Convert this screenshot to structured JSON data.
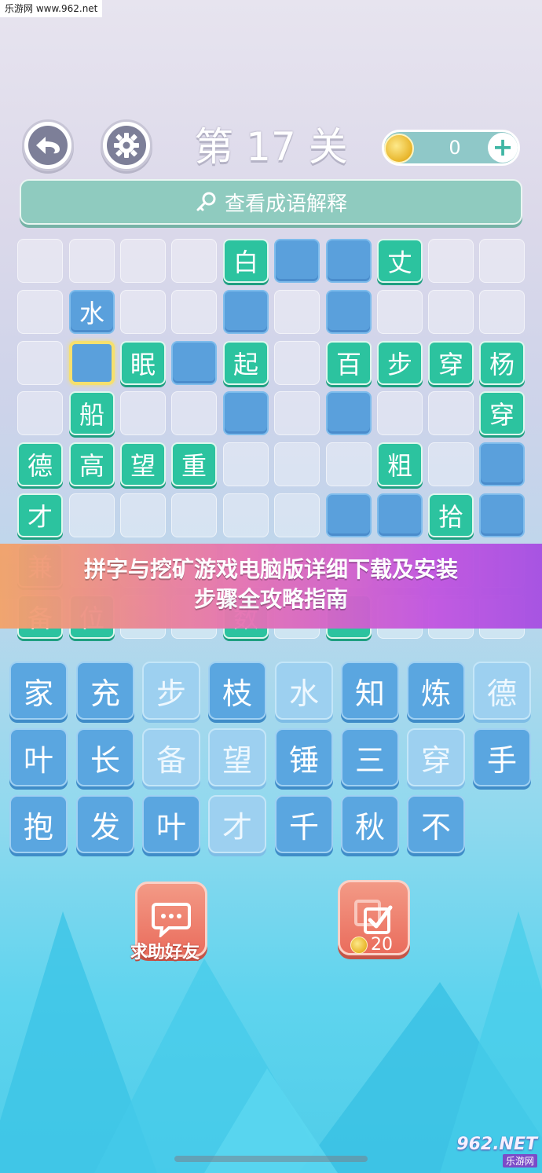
{
  "watermark_top": "乐游网 www.962.net",
  "header": {
    "back_icon": "back-arrow-icon",
    "settings_icon": "gear-icon",
    "level_title": "第 17 关",
    "coins": "0",
    "plus": "+"
  },
  "explain": {
    "label": "查看成语解释",
    "icon": "magnifier-key-icon"
  },
  "banner": {
    "line1": "拼字与挖矿游戏电脑版详细下载及安装",
    "line2": "步骤全攻略指南"
  },
  "grid": {
    "rows": [
      [
        {
          "t": "empty"
        },
        {
          "t": "empty"
        },
        {
          "t": "empty"
        },
        {
          "t": "empty"
        },
        {
          "t": "green",
          "c": "白"
        },
        {
          "t": "blue"
        },
        {
          "t": "blue"
        },
        {
          "t": "green",
          "c": "丈"
        },
        {
          "t": "empty"
        },
        {
          "t": "empty"
        }
      ],
      [
        {
          "t": "empty"
        },
        {
          "t": "blue",
          "c": "水"
        },
        {
          "t": "empty"
        },
        {
          "t": "empty"
        },
        {
          "t": "blue"
        },
        {
          "t": "empty"
        },
        {
          "t": "blue"
        },
        {
          "t": "empty"
        },
        {
          "t": "empty"
        },
        {
          "t": "empty"
        }
      ],
      [
        {
          "t": "empty"
        },
        {
          "t": "selected"
        },
        {
          "t": "green",
          "c": "眠"
        },
        {
          "t": "blue"
        },
        {
          "t": "green",
          "c": "起"
        },
        {
          "t": "empty"
        },
        {
          "t": "green",
          "c": "百"
        },
        {
          "t": "green",
          "c": "步"
        },
        {
          "t": "green",
          "c": "穿"
        },
        {
          "t": "green",
          "c": "杨"
        }
      ],
      [
        {
          "t": "empty"
        },
        {
          "t": "green",
          "c": "船"
        },
        {
          "t": "empty"
        },
        {
          "t": "empty"
        },
        {
          "t": "blue"
        },
        {
          "t": "empty"
        },
        {
          "t": "blue"
        },
        {
          "t": "empty"
        },
        {
          "t": "empty"
        },
        {
          "t": "green",
          "c": "穿"
        }
      ],
      [
        {
          "t": "green",
          "c": "德"
        },
        {
          "t": "green",
          "c": "高"
        },
        {
          "t": "green",
          "c": "望"
        },
        {
          "t": "green",
          "c": "重"
        },
        {
          "t": "empty"
        },
        {
          "t": "empty"
        },
        {
          "t": "empty"
        },
        {
          "t": "green",
          "c": "粗"
        },
        {
          "t": "empty"
        },
        {
          "t": "blue"
        }
      ],
      [
        {
          "t": "green",
          "c": "才"
        },
        {
          "t": "empty"
        },
        {
          "t": "empty"
        },
        {
          "t": "empty"
        },
        {
          "t": "empty"
        },
        {
          "t": "empty"
        },
        {
          "t": "blue"
        },
        {
          "t": "blue"
        },
        {
          "t": "green",
          "c": "拾"
        },
        {
          "t": "blue"
        }
      ],
      [
        {
          "t": "green",
          "c": "兼"
        },
        {
          "t": "empty"
        },
        {
          "t": "empty"
        },
        {
          "t": "empty"
        },
        {
          "t": "empty"
        },
        {
          "t": "empty"
        },
        {
          "t": "empty"
        },
        {
          "t": "empty"
        },
        {
          "t": "empty"
        },
        {
          "t": "empty"
        }
      ],
      [
        {
          "t": "green",
          "c": "备"
        },
        {
          "t": "green",
          "c": "位"
        },
        {
          "t": "empty"
        },
        {
          "t": "empty"
        },
        {
          "t": "green",
          "c": "数"
        },
        {
          "t": "empty"
        },
        {
          "t": "green",
          "c": ""
        },
        {
          "t": "empty"
        },
        {
          "t": "empty"
        },
        {
          "t": "empty"
        }
      ]
    ]
  },
  "choices": [
    [
      {
        "c": "家"
      },
      {
        "c": "充"
      },
      {
        "c": "步",
        "used": true
      },
      {
        "c": "枝"
      },
      {
        "c": "水",
        "used": true
      },
      {
        "c": "知"
      },
      {
        "c": "炼"
      },
      {
        "c": "德",
        "used": true
      }
    ],
    [
      {
        "c": "叶"
      },
      {
        "c": "长"
      },
      {
        "c": "备",
        "used": true
      },
      {
        "c": "望",
        "used": true
      },
      {
        "c": "锤"
      },
      {
        "c": "三"
      },
      {
        "c": "穿",
        "used": true
      },
      {
        "c": "手"
      }
    ],
    [
      {
        "c": "抱"
      },
      {
        "c": "发"
      },
      {
        "c": "叶"
      },
      {
        "c": "才",
        "used": true
      },
      {
        "c": "千"
      },
      {
        "c": "秋"
      },
      {
        "c": "不"
      }
    ]
  ],
  "actions": {
    "help_label": "求助好友",
    "help_icon": "chat-bubble-icon",
    "reveal_icon": "checkbox-icon",
    "reveal_cost": "20"
  },
  "watermark_bottom": {
    "logo": "962.NET",
    "sub": "乐游网"
  },
  "colors": {
    "green_tile": "#2cc39f",
    "blue_tile": "#5aa0dc",
    "choice_tile": "#5aa6e0",
    "action_button": "#ea6d5d",
    "selected_border": "#f6e06e"
  }
}
